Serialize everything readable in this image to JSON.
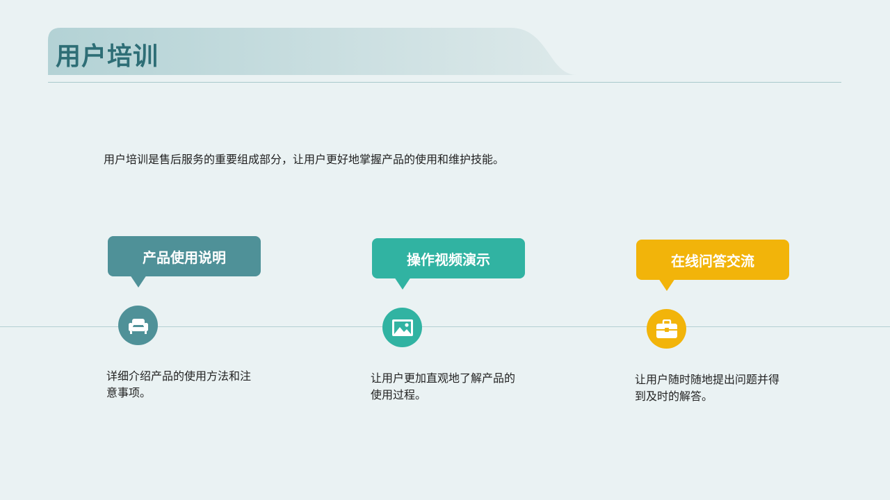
{
  "header": {
    "title": "用户培训"
  },
  "intro": "用户培训是售后服务的重要组成部分，让用户更好地掌握产品的使用和维护技能。",
  "colors": {
    "teal_gray": "#4f9198",
    "teal": "#31b3a2",
    "yellow": "#f2b40a",
    "background": "#eaf2f3"
  },
  "cards": [
    {
      "label": "产品使用说明",
      "icon": "sofa-icon",
      "description": "详细介绍产品的使用方法和注意事项。"
    },
    {
      "label": "操作视频演示",
      "icon": "image-icon",
      "description": "让用户更加直观地了解产品的使用过程。"
    },
    {
      "label": "在线问答交流",
      "icon": "toolbox-icon",
      "description": "让用户随时随地提出问题并得到及时的解答。"
    }
  ]
}
